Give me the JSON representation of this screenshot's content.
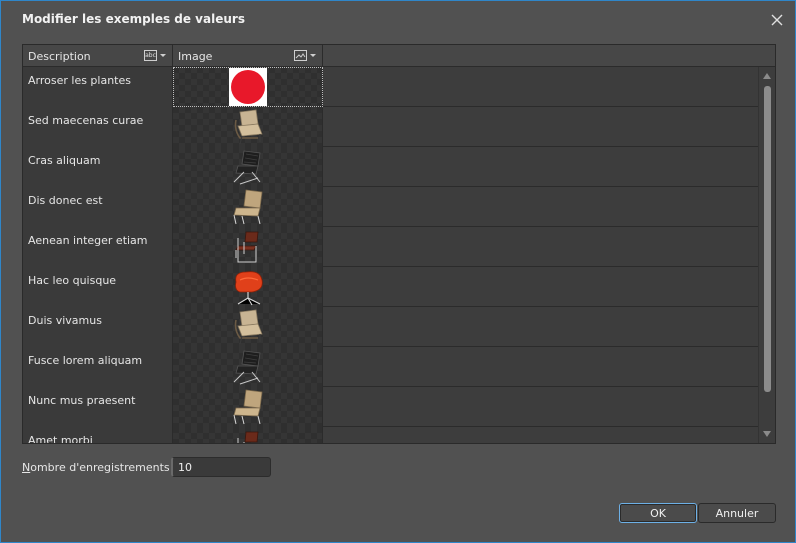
{
  "dialog": {
    "title": "Modifier les exemples de valeurs"
  },
  "grid": {
    "columns": [
      {
        "label": "Description",
        "icon": "abc-text-icon"
      },
      {
        "label": "Image",
        "icon": "image-icon"
      }
    ],
    "rows": [
      {
        "description": "Arroser les plantes",
        "image": "red-circle"
      },
      {
        "description": "Sed maecenas curae",
        "image": "beige-chair"
      },
      {
        "description": "Cras aliquam",
        "image": "black-leather-chair"
      },
      {
        "description": "Dis donec est",
        "image": "tan-chair"
      },
      {
        "description": "Aenean integer etiam",
        "image": "brown-chrome-chair"
      },
      {
        "description": "Hac leo quisque",
        "image": "red-swan-chair"
      },
      {
        "description": "Duis vivamus",
        "image": "beige-chair"
      },
      {
        "description": "Fusce lorem aliquam",
        "image": "black-leather-chair"
      },
      {
        "description": "Nunc mus praesent",
        "image": "tan-chair"
      },
      {
        "description": "Amet morbi",
        "image": "brown-chrome-chair"
      }
    ]
  },
  "record_count": {
    "label_hotkey": "N",
    "label_rest": "ombre d'enregistrements",
    "value": "10"
  },
  "buttons": {
    "ok": "OK",
    "cancel": "Annuler"
  },
  "colors": {
    "dialog_bg": "#515151",
    "grid_bg": "#3d3d3d",
    "accent_border": "#2f86c9",
    "ok_focus": "#6db0e6",
    "selection_red": "#e8182a"
  }
}
